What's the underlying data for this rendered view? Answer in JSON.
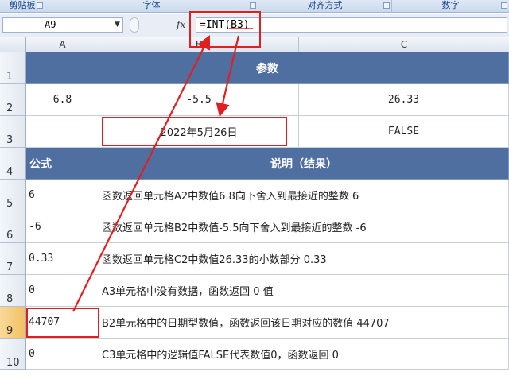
{
  "ribbon": {
    "groups": [
      "剪贴板",
      "字体",
      "对齐方式",
      "数字"
    ]
  },
  "formula_bar": {
    "name_box": "A9",
    "fx_label": "fx",
    "formula": "=INT(B3)"
  },
  "columns": [
    "A",
    "B",
    "C"
  ],
  "rows": [
    "1",
    "2",
    "3",
    "4",
    "5",
    "6",
    "7",
    "8",
    "9",
    "10"
  ],
  "sheet": {
    "params_header": "参数",
    "a2": "6.8",
    "b2": "-5.5",
    "c2": "26.33",
    "a3": "",
    "b3": "2022年5月26日",
    "c3": "FALSE",
    "formula_header": "公式",
    "desc_header": "说明（结果）",
    "results": [
      {
        "value": "6",
        "desc": "函数返回单元格A2中数值6.8向下舍入到最接近的整数 6"
      },
      {
        "value": "-6",
        "desc": "函数返回单元格B2中数值-5.5向下舍入到最接近的整数 -6"
      },
      {
        "value": "0.33",
        "desc": "函数返回单元格C2中数值26.33的小数部分 0.33"
      },
      {
        "value": "0",
        "desc": "A3单元格中没有数据，函数返回 0 值"
      },
      {
        "value": "44707",
        "desc": "B2单元格中的日期型数值，函数返回该日期对应的数值 44707"
      },
      {
        "value": "0",
        "desc": "C3单元格中的逻辑值FALSE代表数值0，函数返回 0"
      }
    ]
  },
  "colors": {
    "header_fill": "#4f6fa0",
    "annotation": "#e02020",
    "selected_row": "#f1c15f"
  }
}
